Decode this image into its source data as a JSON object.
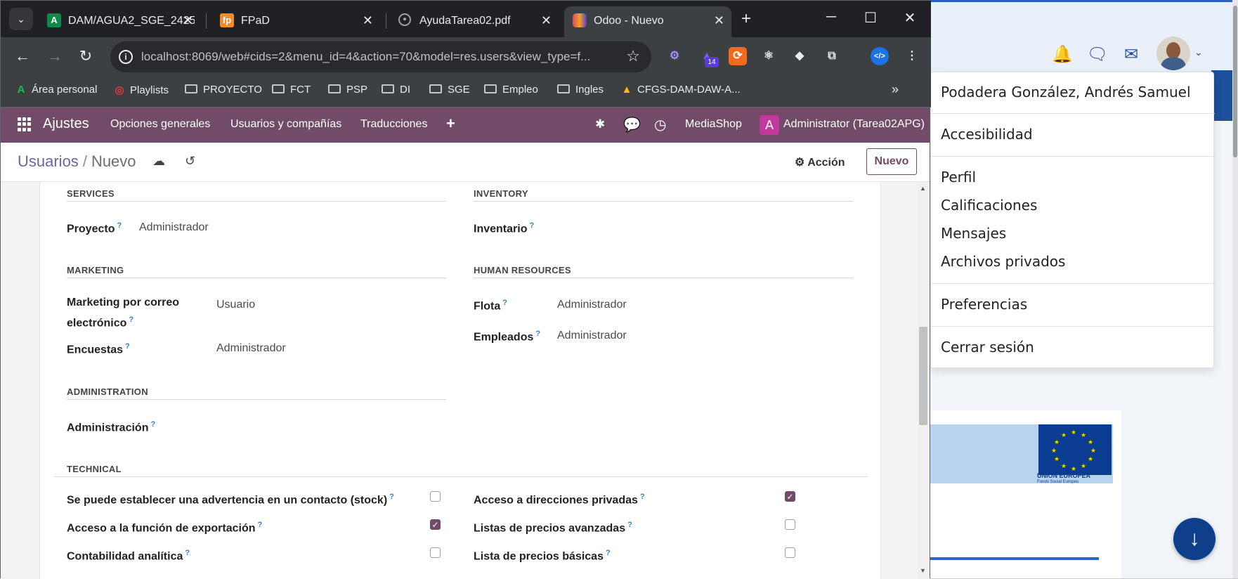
{
  "browser": {
    "tabs": [
      {
        "title": "DAM/AGUA2_SGE_2425_",
        "favicon": "A",
        "favicon_color": "#0b8a4a"
      },
      {
        "title": "FPaD",
        "favicon": "fp",
        "favicon_color": "#f28c28"
      },
      {
        "title": "AyudaTarea02.pdf",
        "favicon": "globe-icon"
      },
      {
        "title": "Odoo - Nuevo",
        "favicon": "odoo-icon",
        "active": true
      }
    ],
    "url": "localhost:8069/web#cids=2&menu_id=4&action=70&model=res.users&view_type=f...",
    "extension_badge": "14",
    "bookmarks": [
      "Área personal",
      "Playlists",
      "PROYECTO",
      "FCT",
      "PSP",
      "DI",
      "SGE",
      "Empleo",
      "Ingles",
      "CFGS-DAM-DAW-A..."
    ],
    "more": "»"
  },
  "odoo": {
    "app": "Ajustes",
    "menu": [
      "Opciones generales",
      "Usuarios y compañías",
      "Traducciones",
      "+"
    ],
    "company": "MediaShop",
    "user_initial": "A",
    "user": "Administrator (Tarea02APG)",
    "accent": "#714b67",
    "breadcrumb": {
      "parent": "Usuarios",
      "sep": "/",
      "current": "Nuevo"
    },
    "action_label": "Acción",
    "new_label": "Nuevo"
  },
  "form": {
    "services": {
      "title": "SERVICES",
      "fields": [
        {
          "label": "Proyecto",
          "value": "Administrador"
        }
      ]
    },
    "inventory": {
      "title": "INVENTORY",
      "fields": [
        {
          "label": "Inventario",
          "value": ""
        }
      ]
    },
    "marketing": {
      "title": "MARKETING",
      "fields": [
        {
          "label": "Marketing por correo electrónico",
          "value": "Usuario"
        },
        {
          "label": "Encuestas",
          "value": "Administrador"
        }
      ]
    },
    "hr": {
      "title": "HUMAN RESOURCES",
      "fields": [
        {
          "label": "Flota",
          "value": "Administrador"
        },
        {
          "label": "Empleados",
          "value": "Administrador"
        }
      ]
    },
    "administration": {
      "title": "ADMINISTRATION",
      "fields": [
        {
          "label": "Administración",
          "value": ""
        }
      ]
    },
    "technical": {
      "title": "TECHNICAL",
      "left": [
        {
          "label": "Se puede establecer una advertencia en un contacto (stock)",
          "checked": false
        },
        {
          "label": "Acceso a la función de exportación",
          "checked": true
        },
        {
          "label": "Contabilidad analítica",
          "checked": false
        }
      ],
      "right": [
        {
          "label": "Acceso a direcciones privadas",
          "checked": true
        },
        {
          "label": "Listas de precios avanzadas",
          "checked": false
        },
        {
          "label": "Lista de precios básicas",
          "checked": false
        }
      ]
    },
    "help_mark": "?"
  },
  "user_menu": {
    "name": "Podadera González, Andrés Samuel",
    "items": [
      "Accesibilidad",
      "Perfil",
      "Calificaciones",
      "Mensajes",
      "Archivos privados",
      "Preferencias",
      "Cerrar sesión"
    ]
  },
  "background_page": {
    "eu_label": "UNIÓN EUROPEA",
    "eu_sub": "Fondo Social Europeo"
  }
}
